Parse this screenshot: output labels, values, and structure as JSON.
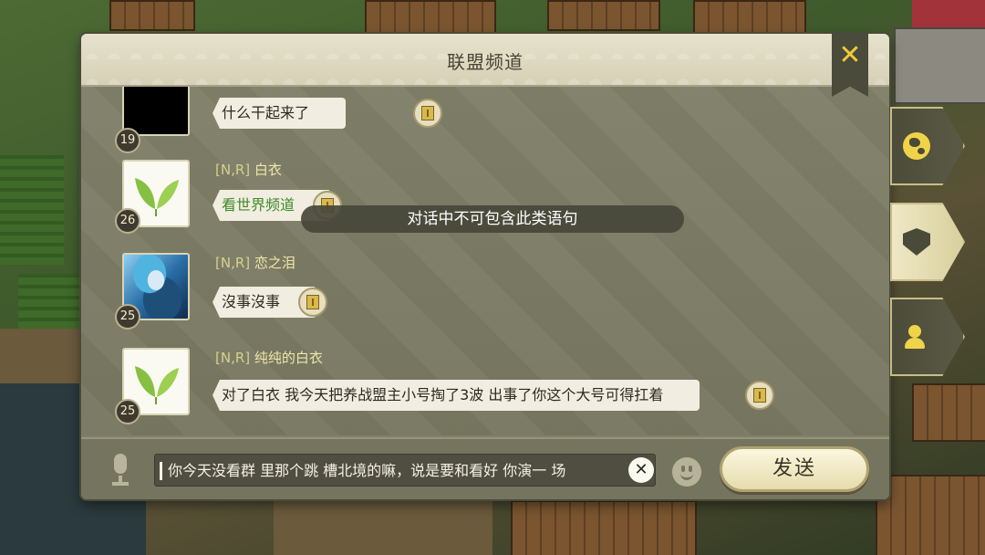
{
  "dialog": {
    "title": "联盟频道",
    "close_icon": "close-icon"
  },
  "messages": [
    {
      "avatar": "black-avatar",
      "level": "19",
      "name_tag": "",
      "name": "",
      "text": "什么干起来了"
    },
    {
      "avatar": "leaf-avatar",
      "level": "26",
      "name_tag": "[N,R]",
      "name": "白衣",
      "text": "看世界频道"
    },
    {
      "avatar": "anime-avatar",
      "level": "25",
      "name_tag": "[N,R]",
      "name": "恋之泪",
      "text": "沒事沒事"
    },
    {
      "avatar": "leaf-avatar",
      "level": "25",
      "name_tag": "[N,R]",
      "name": "纯纯的白衣",
      "text": "对了白衣 我今天把养战盟主小号掏了3波 出事了你这个大号可得扛着"
    }
  ],
  "toast": "对话中不可包含此类语句",
  "input": {
    "value": "你今天没看群 里那个跳 槽北境的嘛，说是要和看好 你演一 场",
    "clear_icon": "✕",
    "emoji_icon": "smiley-icon",
    "mic_icon": "microphone-icon"
  },
  "send_label": "发送",
  "side_tabs": [
    {
      "icon": "globe-icon",
      "active": false
    },
    {
      "icon": "alliance-shield-icon",
      "active": true
    },
    {
      "icon": "private-chat-icon",
      "active": false
    }
  ],
  "colors": {
    "panel": "#7b7b64",
    "header": "#e2dcc3",
    "name_text": "#f0e6a8",
    "accent_yellow": "#f2c83a",
    "green_link": "#3f8a2a"
  }
}
